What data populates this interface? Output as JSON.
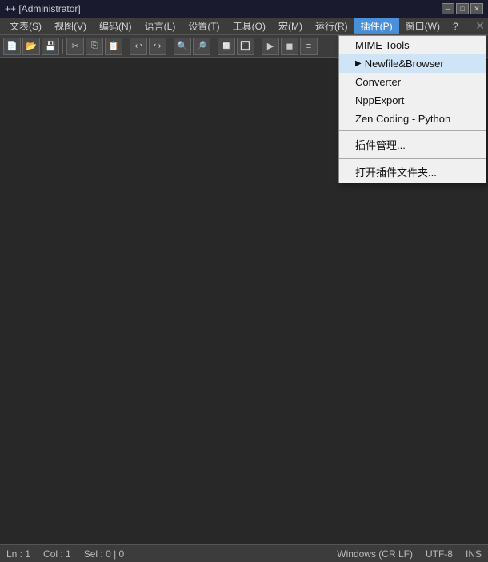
{
  "titlebar": {
    "title": "++ [Administrator]",
    "controls": {
      "minimize": "─",
      "maximize": "□",
      "close": "✕"
    }
  },
  "menubar": {
    "items": [
      {
        "label": "文表(S)",
        "active": false
      },
      {
        "label": "视图(V)",
        "active": false
      },
      {
        "label": "编码(N)",
        "active": false
      },
      {
        "label": "语言(L)",
        "active": false
      },
      {
        "label": "设置(T)",
        "active": false
      },
      {
        "label": "工具(O)",
        "active": false
      },
      {
        "label": "宏(M)",
        "active": false
      },
      {
        "label": "运行(R)",
        "active": false
      },
      {
        "label": "插件(P)",
        "active": true
      },
      {
        "label": "窗口(W)",
        "active": false
      },
      {
        "label": "?",
        "active": false
      }
    ]
  },
  "dropdown": {
    "items": [
      {
        "label": "MIME Tools",
        "type": "item"
      },
      {
        "label": "Newfile&Browser",
        "type": "item",
        "highlighted": true
      },
      {
        "label": "Converter",
        "type": "item"
      },
      {
        "label": "NppExport",
        "type": "item"
      },
      {
        "label": "Zen Coding - Python",
        "type": "item"
      },
      {
        "type": "separator"
      },
      {
        "label": "插件管理...",
        "type": "item"
      },
      {
        "type": "separator"
      },
      {
        "label": "打开插件文件夹...",
        "type": "item"
      }
    ]
  },
  "statusbar": {
    "ln": "Ln : 1",
    "col": "Col : 1",
    "sel": "Sel : 0 | 0",
    "line_ending": "Windows (CR LF)",
    "encoding": "UTF-8",
    "mode": "INS"
  },
  "toolbar": {
    "buttons": [
      "📄",
      "📂",
      "💾",
      "✂",
      "📋",
      "📋",
      "↩",
      "↪",
      "🔍",
      "🔍",
      "🖊",
      "🔲",
      "🔲",
      "🔲",
      "▶",
      "📐",
      "📋"
    ]
  }
}
